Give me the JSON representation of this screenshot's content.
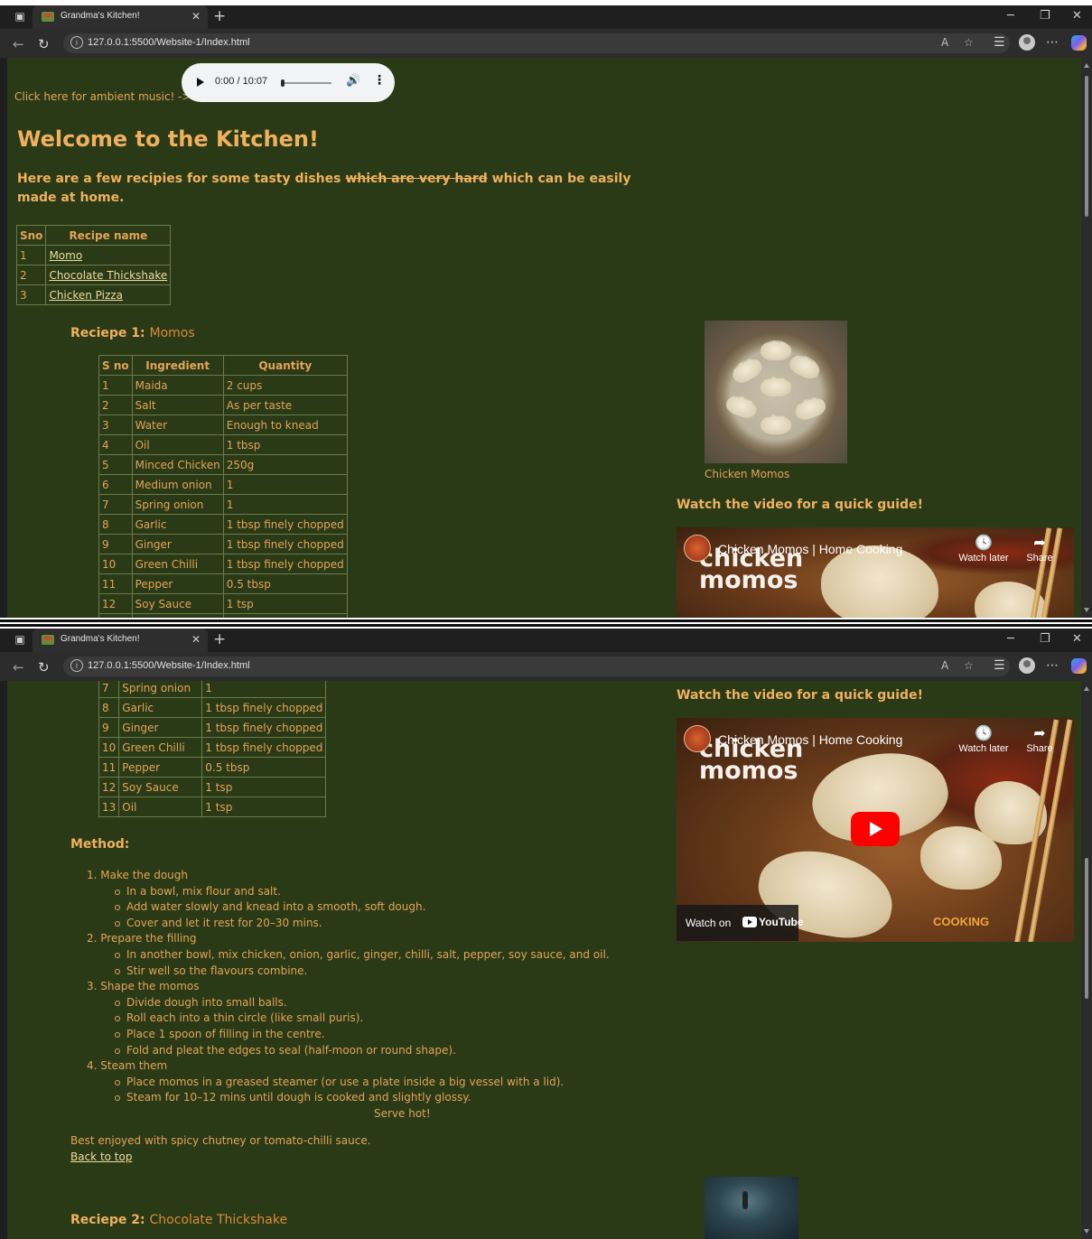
{
  "browser": {
    "tab_title": "Grandma's Kitchen!",
    "url": "127.0.0.1:5500/Website-1/Index.html"
  },
  "page": {
    "ambient_text": "Click here for ambient music! ->",
    "audio": {
      "time": "0:00 / 10:07",
      "progress": 0.0
    },
    "heading": "Welcome to the Kitchen!",
    "intro_before": "Here are a few recipies for some tasty dishes ",
    "intro_struck": "which are very hard",
    "intro_after": " which can be easily made at home.",
    "recipe_table": {
      "headers": [
        "Sno",
        "Recipe name"
      ],
      "rows": [
        {
          "sno": "1",
          "name": "Momo"
        },
        {
          "sno": "2",
          "name": "Chocolate Thickshake"
        },
        {
          "sno": "3",
          "name": "Chicken Pizza"
        }
      ]
    },
    "recipe1": {
      "label": "Reciepe 1: ",
      "name": "Momos",
      "ingredients_headers": [
        "S no",
        "Ingredient",
        "Quantity"
      ],
      "ingredients": [
        [
          "1",
          "Maida",
          "2 cups"
        ],
        [
          "2",
          "Salt",
          "As per taste"
        ],
        [
          "3",
          "Water",
          "Enough to knead"
        ],
        [
          "4",
          "Oil",
          "1 tbsp"
        ],
        [
          "5",
          "Minced Chicken",
          "250g"
        ],
        [
          "6",
          "Medium onion",
          "1"
        ],
        [
          "7",
          "Spring onion",
          "1"
        ],
        [
          "8",
          "Garlic",
          "1 tbsp finely chopped"
        ],
        [
          "9",
          "Ginger",
          "1 tbsp finely chopped"
        ],
        [
          "10",
          "Green Chilli",
          "1 tbsp finely chopped"
        ],
        [
          "11",
          "Pepper",
          "0.5 tbsp"
        ],
        [
          "12",
          "Soy Sauce",
          "1 tsp"
        ],
        [
          "13",
          "Oil",
          "1 tsp"
        ]
      ],
      "image_caption": "Chicken Momos",
      "video_heading": "Watch the video for a quick guide!",
      "video": {
        "title": "Chicken Momos | Home Cooking",
        "overlay_line1": "chicken",
        "overlay_line2": "momos",
        "watch_later": "Watch later",
        "share": "Share",
        "watch_on": "Watch on",
        "youtube": "YouTube",
        "brand": "COOKING"
      },
      "method_heading": "Method:",
      "steps": [
        {
          "title": "Make the dough",
          "items": [
            "In a bowl, mix flour and salt.",
            "Add water slowly and knead into a smooth, soft dough.",
            "Cover and let it rest for 20–30 mins."
          ]
        },
        {
          "title": "Prepare the filling",
          "items": [
            "In another bowl, mix chicken, onion, garlic, ginger, chilli, salt, pepper, soy sauce, and oil.",
            "Stir well so the flavours combine."
          ]
        },
        {
          "title": "Shape the momos",
          "items": [
            "Divide dough into small balls.",
            "Roll each into a thin circle (like small puris).",
            "Place 1 spoon of filling in the centre.",
            "Fold and pleat the edges to seal (half-moon or round shape)."
          ]
        },
        {
          "title": "Steam them",
          "items": [
            "Place momos in a greased steamer (or use a plate inside a big vessel with a lid).",
            "Steam for 10–12 mins until dough is cooked and slightly glossy."
          ]
        }
      ],
      "serve": "Serve hot!",
      "best": "Best enjoyed with spicy chutney or tomato-chilli sauce.",
      "back_to_top": "Back to top"
    },
    "recipe2": {
      "label": "Reciepe 2: ",
      "name": "Chocolate Thickshake"
    }
  },
  "colors": {
    "page_bg": "#2a3a17",
    "text": "#e4a458",
    "link": "#efdc9c"
  }
}
